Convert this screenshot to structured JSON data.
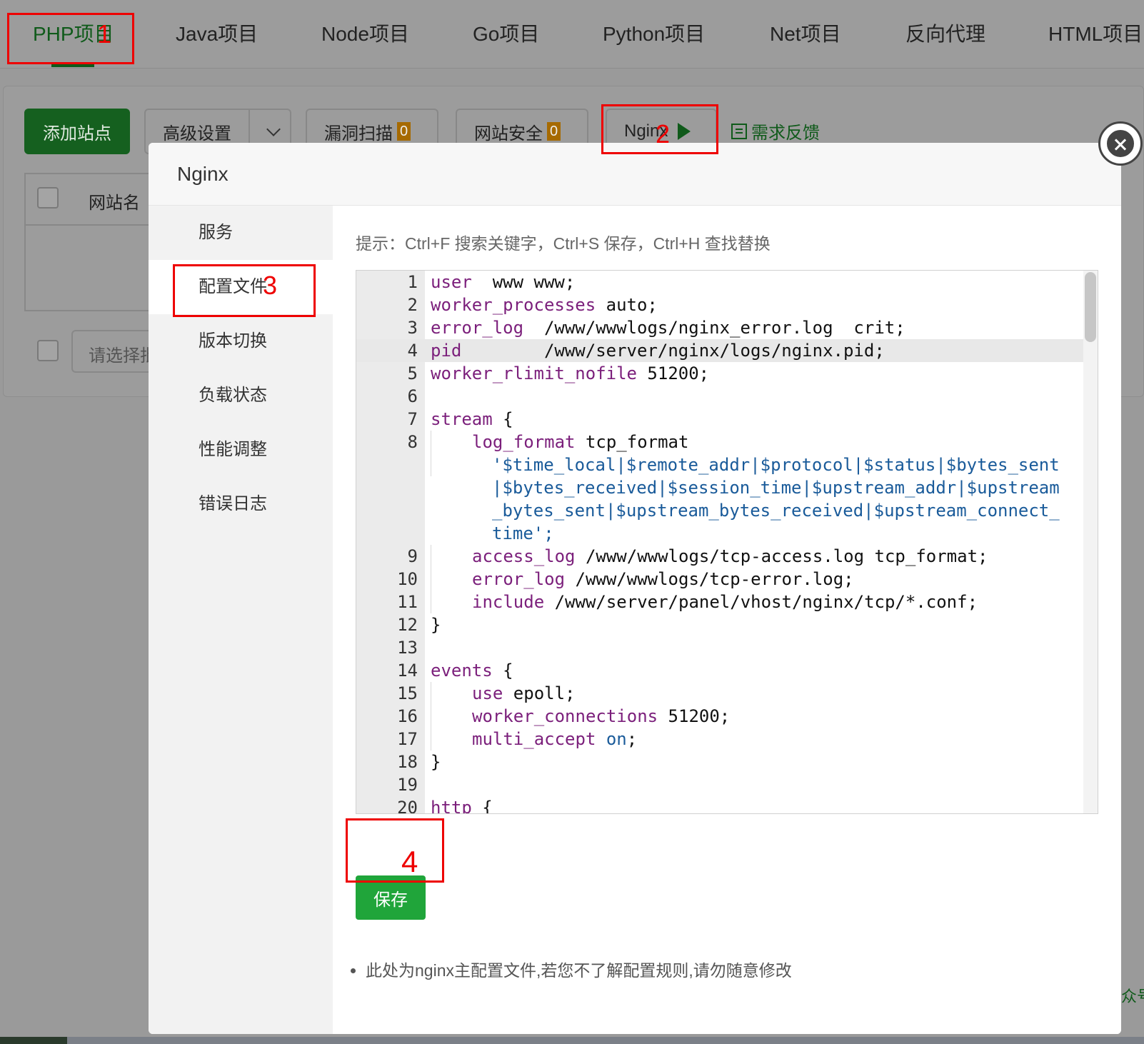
{
  "top_tabs": [
    {
      "label": "PHP项目",
      "active": true
    },
    {
      "label": "Java项目"
    },
    {
      "label": "Node项目"
    },
    {
      "label": "Go项目"
    },
    {
      "label": "Python项目"
    },
    {
      "label": "Net项目"
    },
    {
      "label": "反向代理"
    },
    {
      "label": "HTML项目"
    }
  ],
  "toolbar": {
    "add_site": "添加站点",
    "advanced": "高级设置",
    "vuln_scan": "漏洞扫描",
    "vuln_count": "0",
    "site_security": "网站安全",
    "security_count": "0",
    "nginx": "Nginx",
    "feedback": "需求反馈"
  },
  "table": {
    "col_site_name": "网站名",
    "select_placeholder": "请选择批"
  },
  "modal": {
    "title": "Nginx",
    "nav": [
      "服务",
      "配置文件",
      "版本切换",
      "负载状态",
      "性能调整",
      "错误日志"
    ],
    "active_nav_index": 1,
    "hint": "提示：Ctrl+F 搜索关键字，Ctrl+S 保存，Ctrl+H 查找替换",
    "save_label": "保存",
    "note": "此处为nginx主配置文件,若您不了解配置规则,请勿随意修改"
  },
  "editor": {
    "active_line": 4,
    "lines": [
      {
        "n": "1",
        "k": "user",
        "r": "  www www;"
      },
      {
        "n": "2",
        "k": "worker_processes",
        "r": " auto;"
      },
      {
        "n": "3",
        "k": "error_log",
        "r": "  /www/wwwlogs/nginx_error.log  crit;"
      },
      {
        "n": "4",
        "k": "pid",
        "r": "        /www/server/nginx/logs/nginx.pid;"
      },
      {
        "n": "5",
        "k": "worker_rlimit_nofile",
        "r": " 51200;"
      },
      {
        "n": "6",
        "k": "",
        "r": ""
      },
      {
        "n": "7",
        "k": "stream",
        "r": " {"
      },
      {
        "n": "8",
        "k": "log_format",
        "r": " tcp_format",
        "indent": 1
      },
      {
        "n": "",
        "k": "",
        "s": "'$time_local|$remote_addr|$protocol|$status|$bytes_sent|$bytes_received|$session_time|$upstream_addr|$upstream_bytes_sent|$upstream_bytes_received|$upstream_connect_time';",
        "indent": 1,
        "wrap": true
      },
      {
        "n": "9",
        "k": "access_log",
        "r": " /www/wwwlogs/tcp-access.log tcp_format;",
        "indent": 1
      },
      {
        "n": "10",
        "k": "error_log",
        "r": " /www/wwwlogs/tcp-error.log;",
        "indent": 1
      },
      {
        "n": "11",
        "k": "include",
        "r": " /www/server/panel/vhost/nginx/tcp/*.conf;",
        "indent": 1
      },
      {
        "n": "12",
        "k": "",
        "r": "}"
      },
      {
        "n": "13",
        "k": "",
        "r": ""
      },
      {
        "n": "14",
        "k": "events",
        "r": " {"
      },
      {
        "n": "15",
        "k": "use",
        "r": " epoll;",
        "indent": 1
      },
      {
        "n": "16",
        "k": "worker_connections",
        "r": " 51200;",
        "indent": 1
      },
      {
        "n": "17",
        "k": "multi_accept",
        "r": " ",
        "v": "on",
        "tail": ";",
        "indent": 1
      },
      {
        "n": "18",
        "k": "",
        "r": "}"
      },
      {
        "n": "19",
        "k": "",
        "r": ""
      },
      {
        "n": "20",
        "k": "http",
        "r": " {"
      }
    ]
  },
  "annotations": [
    "1",
    "2",
    "3",
    "4"
  ],
  "stray_text": "众号",
  "colors": {
    "brand_green": "#20a53a",
    "annotation_red": "#e00000",
    "keyword": "#7b1f7b",
    "variable": "#1a5b9a"
  }
}
